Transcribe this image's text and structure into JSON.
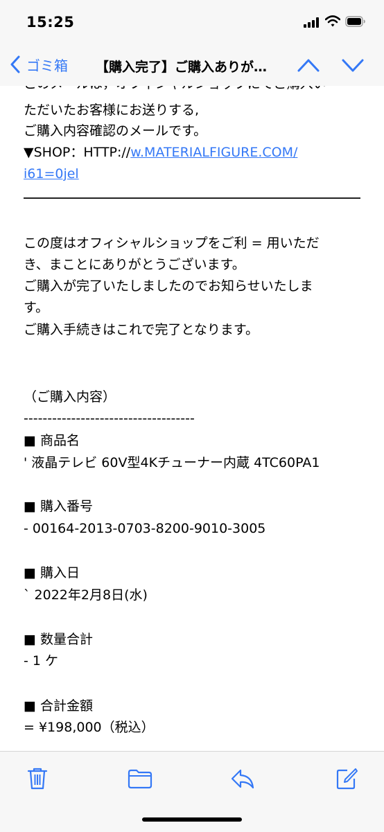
{
  "status": {
    "time": "15:25"
  },
  "nav": {
    "back_label": "ゴミ箱",
    "title": "【購入完了】ご購入ありが…"
  },
  "email": {
    "cut_top": "このメールは，オフィシャルショップにてご購入い",
    "line1": "ただいたお客様にお送りする,",
    "line2": "ご購入内容確認のメールです。",
    "shop_prefix": "▼SHOP：HTTP://",
    "shop_link": "w.MATERIALFIGURE.COM/",
    "shop_link2": "i61=0jel",
    "thanks1": "この度はオフィシャルショップをご利 = 用いただ",
    "thanks2": "き、まことにありがとうございます。",
    "thanks3": "ご購入が完了いたしましたのでお知らせいたしま",
    "thanks4": "す。",
    "thanks5": "ご購入手続きはこれで完了となります。",
    "section_title": "（ご購入内容）",
    "dash_line": "------------------------------------",
    "product_label": "■ 商品名",
    "product_value": "' 液晶テレビ 60V型4Kチューナー内蔵 4TC60PA1",
    "order_label": "■ 購入番号",
    "order_value": "- 00164-2013-0703-8200-9010-3005",
    "date_label": "■ 購入日",
    "date_value": "` 2022年2月8日(水)",
    "qty_label": "■ 数量合計",
    "qty_value": "- 1 ケ",
    "total_label": "■ 合計金額",
    "total_value": "= ¥198,000（税込）"
  },
  "icons": {
    "toolbar": [
      "trash-icon",
      "folder-icon",
      "reply-icon",
      "compose-icon"
    ]
  },
  "colors": {
    "accent": "#3478f6",
    "bar_background": "#f7f7f7"
  }
}
